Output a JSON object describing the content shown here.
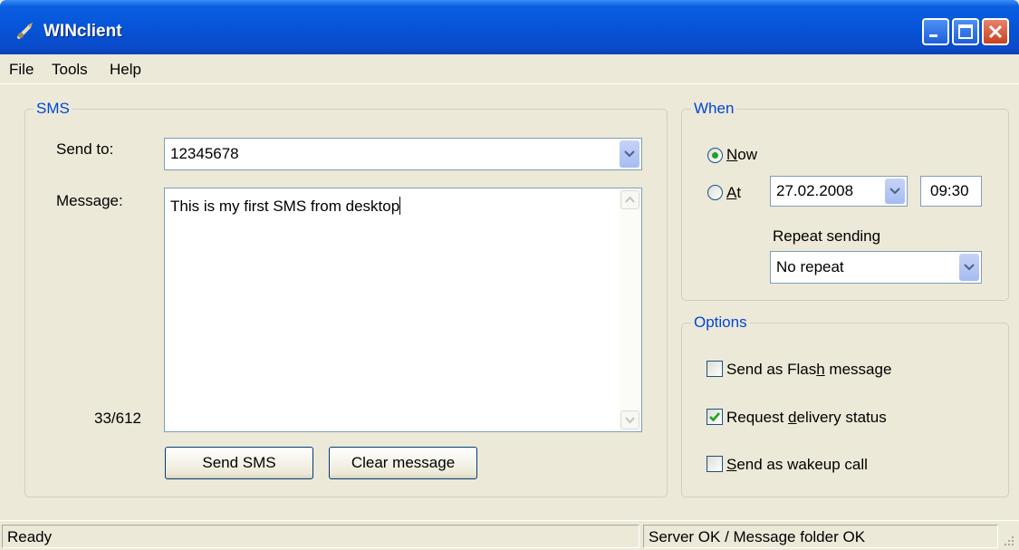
{
  "window": {
    "title": "WINclient",
    "icon": "satellite-dish-icon"
  },
  "menu": {
    "file": "File",
    "tools": "Tools",
    "help": "Help"
  },
  "sms": {
    "group_label": "SMS",
    "send_to_label": "Send to:",
    "send_to_value": "12345678",
    "message_label": "Message:",
    "message_text": "This is my first SMS from desktop",
    "char_count": "33/612",
    "send_button": "Send SMS",
    "clear_button": "Clear message"
  },
  "when": {
    "group_label": "When",
    "now_accel": "N",
    "now_rest": "ow",
    "now_selected": true,
    "at_accel": "A",
    "at_rest": "t",
    "date": "27.02.2008",
    "time": "09:30",
    "repeat_label": "Repeat sending",
    "repeat_value": "No repeat"
  },
  "options": {
    "group_label": "Options",
    "flash_pre": "Send as Flas",
    "flash_accel": "h",
    "flash_post": " message",
    "flash_checked": false,
    "delivery_pre": "Request ",
    "delivery_accel": "d",
    "delivery_post": "elivery status",
    "delivery_checked": true,
    "wakeup_accel": "S",
    "wakeup_post": "end as wakeup call",
    "wakeup_checked": false
  },
  "status": {
    "left": "Ready",
    "right": "Server OK / Message folder OK"
  },
  "colors": {
    "titlebar": "#0654d8",
    "accent_text": "#0046d5",
    "face": "#ece9d8",
    "radio_dot": "#21a121"
  }
}
